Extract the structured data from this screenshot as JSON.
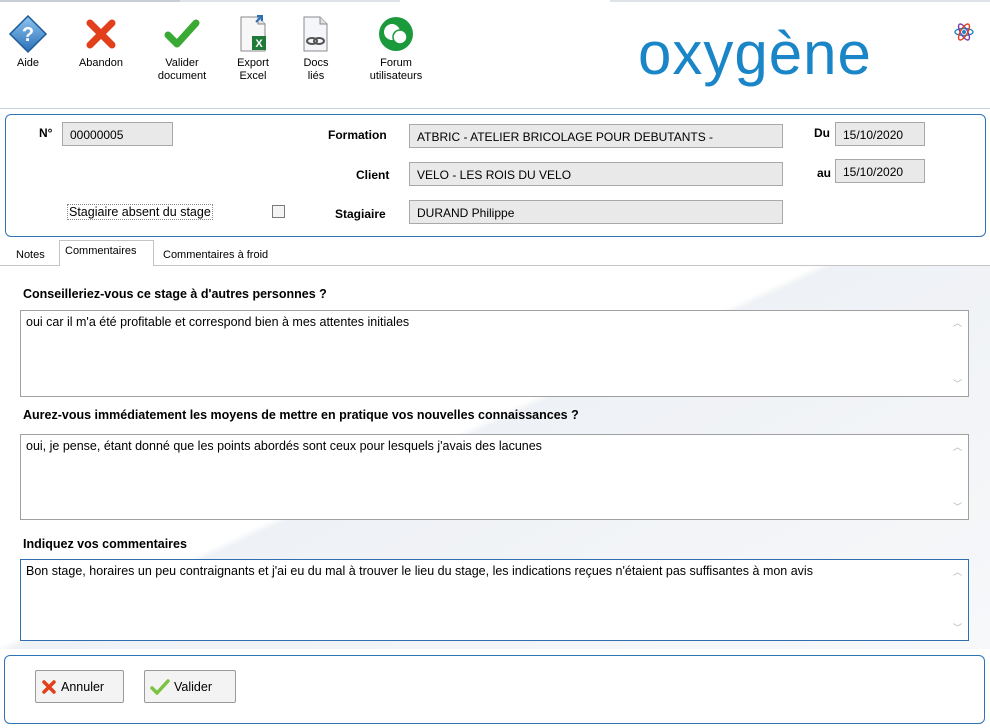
{
  "toolbar": {
    "buttons": [
      {
        "label": "Aide",
        "icon": "help-icon"
      },
      {
        "label": "Abandon",
        "icon": "cross-icon"
      },
      {
        "label": "Valider\ndocument",
        "icon": "checkmark-icon"
      },
      {
        "label": "Export\nExcel",
        "icon": "excel-export-icon"
      },
      {
        "label": "Docs\nliés",
        "icon": "linked-docs-icon"
      },
      {
        "label": "Forum\nutilisateurs",
        "icon": "forum-icon"
      }
    ]
  },
  "brand": {
    "logo_text": "oxygène",
    "color": "#1a86c8"
  },
  "header": {
    "num_label": "N°",
    "num_value": "00000005",
    "formation_label": "Formation",
    "formation_value": "ATBRIC - ATELIER BRICOLAGE POUR DEBUTANTS -",
    "client_label": "Client",
    "client_value": "VELO - LES ROIS DU VELO",
    "stagiaire_label": "Stagiaire",
    "stagiaire_value": "DURAND Philippe",
    "du_label": "Du",
    "du_value": "15/10/2020",
    "au_label": "au",
    "au_value": "15/10/2020",
    "absent_label": "Stagiaire absent du stage",
    "absent_checked": false
  },
  "tabs": [
    {
      "label": "Notes",
      "active": false
    },
    {
      "label": "Commentaires",
      "active": true
    },
    {
      "label": "Commentaires à froid",
      "active": false
    }
  ],
  "comments": [
    {
      "question": "Conseilleriez-vous ce stage à d'autres personnes ?",
      "answer": "oui car il m'a été profitable et correspond bien à mes attentes initiales"
    },
    {
      "question": "Aurez-vous immédiatement les moyens de mettre en pratique vos nouvelles connaissances ?",
      "answer": "oui, je pense, étant donné que les points abordés sont ceux pour lesquels j'avais des lacunes"
    },
    {
      "question": "Indiquez vos commentaires",
      "answer": "Bon stage, horaires un peu contraignants et j'ai eu du mal à trouver le lieu du stage, les indications reçues n'étaient pas suffisantes à mon avis"
    }
  ],
  "footer": {
    "cancel_label": "Annuler",
    "validate_label": "Valider"
  },
  "colors": {
    "panel_border": "#2f74b5",
    "field_bg": "#e9e9e9",
    "accent_green": "#3aaa35",
    "accent_red": "#e2401c"
  }
}
